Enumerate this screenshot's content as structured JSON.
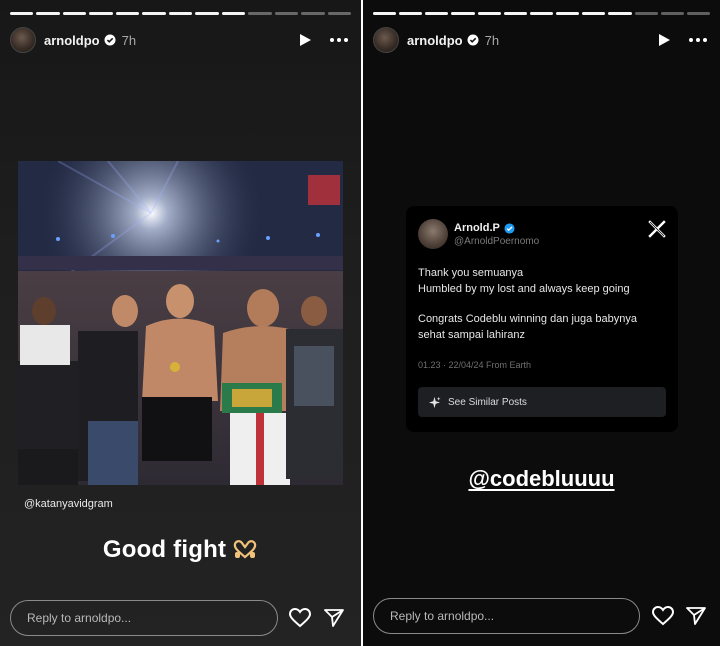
{
  "colors": {
    "left_bg": "#1e1e1e",
    "right_bg": "#0c0c0c",
    "text": "#ffffff",
    "muted": "#a8a8a8",
    "verified_blue": "#1d9bf0"
  },
  "left_story": {
    "username": "arnoldpo",
    "time": "7h",
    "photo_credit": "@katanyavidgram",
    "caption": "Good fight",
    "caption_emoji": "heart-hands",
    "reply_placeholder": "Reply to arnoldpo...",
    "progress_segments": 13,
    "progress_done": 9
  },
  "right_story": {
    "username": "arnoldpo",
    "time": "7h",
    "tweet": {
      "name": "Arnold.P",
      "handle": "@ArnoldPoernomo",
      "lines": [
        "Thank you semuanya",
        "Humbled by my lost and always keep going",
        "Congrats Codeblu winning dan juga babynya",
        "sehat sampai lahiranz"
      ],
      "meta": "01.23 · 22/04/24 From Earth",
      "similar_label": "See Similar Posts"
    },
    "mention": "@codebluuuu",
    "reply_placeholder": "Reply to arnoldpo...",
    "progress_segments": 13,
    "progress_done": 10
  },
  "icons": [
    "verified-icon",
    "play-icon",
    "more-icon",
    "heart-icon",
    "send-icon",
    "x-logo-icon",
    "sparkle-icon",
    "heart-hands-icon"
  ]
}
